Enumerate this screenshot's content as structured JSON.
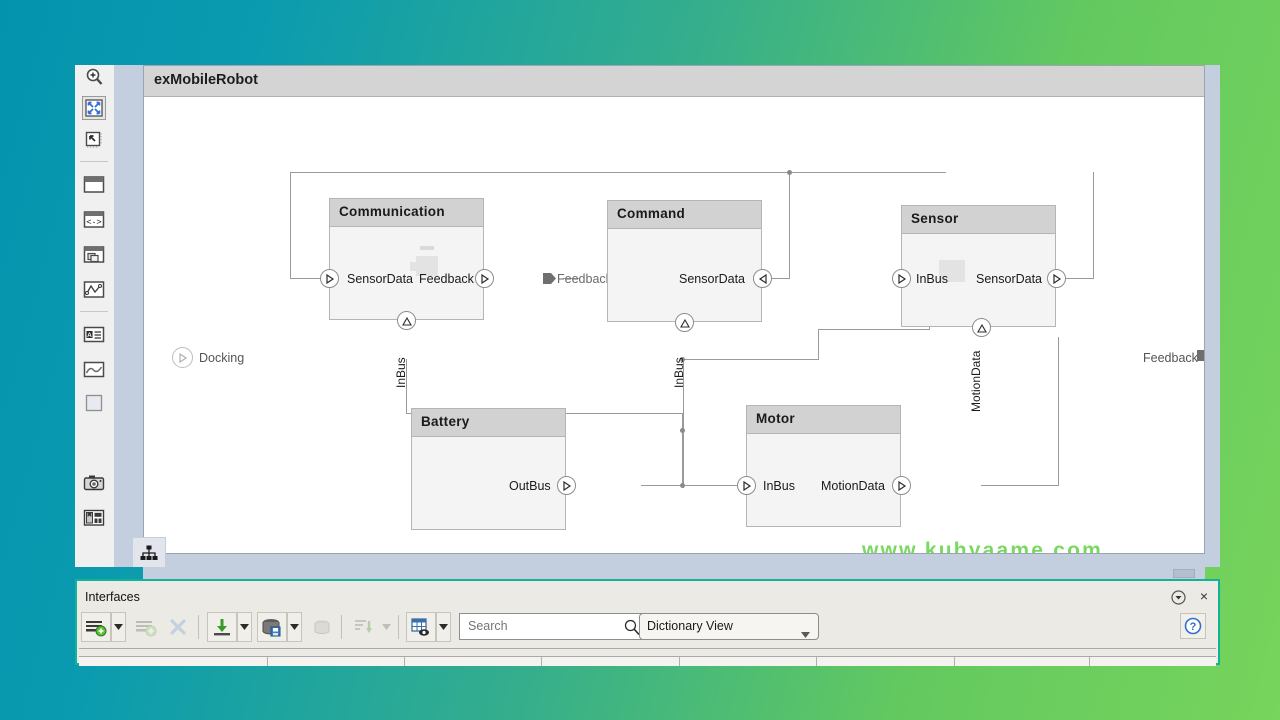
{
  "model": {
    "title": "exMobileRobot",
    "watermark": "www.kuhyaame.com",
    "blocks": [
      {
        "name": "Communication",
        "ports_in": [
          "SensorData"
        ],
        "ports_out": [
          "Feedback"
        ],
        "port_bottom": "InBus"
      },
      {
        "name": "Command",
        "ports_in": [
          "SensorData"
        ],
        "ports_out": [],
        "port_bottom": "InBus"
      },
      {
        "name": "Sensor",
        "ports_in": [
          "InBus"
        ],
        "ports_out": [
          "SensorData"
        ],
        "port_bottom": "MotionData"
      },
      {
        "name": "Battery",
        "ports_in": [],
        "ports_out": [
          "OutBus"
        ],
        "port_bottom": ""
      },
      {
        "name": "Motor",
        "ports_in": [
          "InBus"
        ],
        "ports_out": [
          "MotionData"
        ],
        "port_bottom": ""
      }
    ],
    "external_ports": [
      {
        "label": "Docking",
        "side": "left"
      },
      {
        "label": "Feedback",
        "side": "right"
      }
    ]
  },
  "left_toolbar": {
    "items": [
      {
        "icon": "zoom-fit-icon"
      },
      {
        "icon": "fit-to-view-icon"
      },
      {
        "icon": "zoom-region-icon"
      },
      {
        "icon": "panel-top-icon"
      },
      {
        "icon": "code-view-icon"
      },
      {
        "icon": "duplicate-window-icon"
      },
      {
        "icon": "spline-icon"
      },
      {
        "icon": "annotation-icon"
      },
      {
        "icon": "image-icon"
      },
      {
        "icon": "area-icon"
      },
      {
        "icon": "camera-icon"
      },
      {
        "icon": "report-icon"
      },
      {
        "icon": "more-icon"
      }
    ],
    "more_label": "»"
  },
  "canvas_footer": {
    "hierarchy_icon": "hierarchy-icon"
  },
  "interfaces": {
    "title": "Interfaces",
    "collapse_icon": "chevron-down-circle-icon",
    "close_label": "×",
    "toolbar": [
      {
        "icon": "add-interface-icon",
        "has_arrow": true,
        "enabled": true
      },
      {
        "icon": "add-element-icon",
        "has_arrow": false,
        "enabled": false
      },
      {
        "icon": "delete-icon",
        "has_arrow": false,
        "enabled": false
      },
      {
        "icon": "import-icon",
        "has_arrow": true,
        "enabled": true
      },
      {
        "icon": "save-dictionary-icon",
        "has_arrow": true,
        "enabled": true
      },
      {
        "icon": "link-dictionary-icon",
        "has_arrow": false,
        "enabled": false
      },
      {
        "icon": "sort-icon",
        "has_arrow": true,
        "enabled": false
      },
      {
        "icon": "view-options-icon",
        "has_arrow": true,
        "enabled": true
      }
    ],
    "search": {
      "placeholder": "Search",
      "value": "",
      "icon": "search-icon"
    },
    "view_select": {
      "value": "Dictionary View",
      "icon": "chevron-down-icon"
    },
    "help": {
      "icon": "help-icon"
    },
    "grid_columns": [
      "",
      "",
      "",
      "",
      ""
    ]
  }
}
